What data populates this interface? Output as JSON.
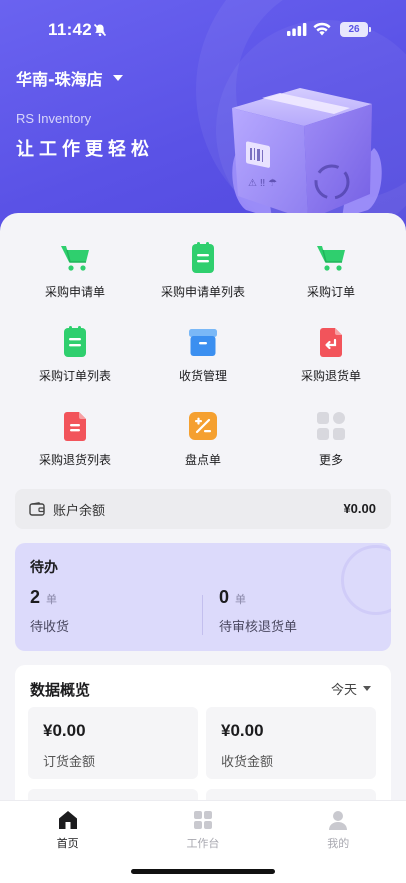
{
  "status_bar": {
    "time": "11:42",
    "battery": "26"
  },
  "header": {
    "store_name": "华南-珠海店",
    "brand": "RS Inventory",
    "slogan": "让工作更轻松"
  },
  "menu": [
    {
      "label": "采购申请单",
      "icon": "cart-icon",
      "color": "#2fcf6e"
    },
    {
      "label": "采购申请单列表",
      "icon": "clipboard-icon",
      "color": "#2fcf6e"
    },
    {
      "label": "采购订单",
      "icon": "cart-icon",
      "color": "#2fcf6e"
    },
    {
      "label": "采购订单列表",
      "icon": "clipboard-icon",
      "color": "#2fcf6e"
    },
    {
      "label": "收货管理",
      "icon": "box-icon",
      "color": "#3b8ff0"
    },
    {
      "label": "采购退货单",
      "icon": "return-doc-icon",
      "color": "#f2545b"
    },
    {
      "label": "采购退货列表",
      "icon": "doc-icon",
      "color": "#f2545b"
    },
    {
      "label": "盘点单",
      "icon": "percent-icon",
      "color": "#f5a030"
    },
    {
      "label": "更多",
      "icon": "more-grid-icon",
      "color": "#d8d8de"
    }
  ],
  "balance": {
    "label": "账户余额",
    "amount": "¥0.00"
  },
  "todo": {
    "title": "待办",
    "items": [
      {
        "count": "2",
        "unit": "单",
        "label": "待收货"
      },
      {
        "count": "0",
        "unit": "单",
        "label": "待审核退货单"
      }
    ]
  },
  "overview": {
    "title": "数据概览",
    "period": "今天",
    "stats": [
      {
        "value": "¥0.00",
        "label": "订货金额"
      },
      {
        "value": "¥0.00",
        "label": "收货金额"
      }
    ]
  },
  "tabbar": [
    {
      "label": "首页",
      "icon": "home-icon"
    },
    {
      "label": "工作台",
      "icon": "workbench-icon"
    },
    {
      "label": "我的",
      "icon": "profile-icon"
    }
  ],
  "colors": {
    "primary": "#5a52e6",
    "todo_bg": "#dcdafb"
  }
}
